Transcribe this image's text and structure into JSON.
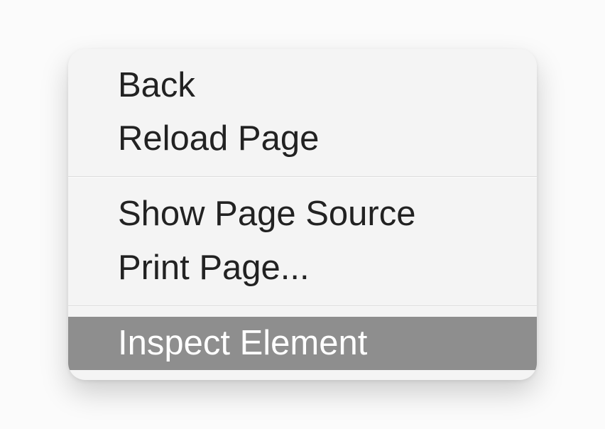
{
  "menu": {
    "items": [
      {
        "label": "Back",
        "highlighted": false
      },
      {
        "label": "Reload Page",
        "highlighted": false
      },
      {
        "label": "Show Page Source",
        "highlighted": false
      },
      {
        "label": "Print Page...",
        "highlighted": false
      },
      {
        "label": "Inspect Element",
        "highlighted": true
      }
    ]
  }
}
